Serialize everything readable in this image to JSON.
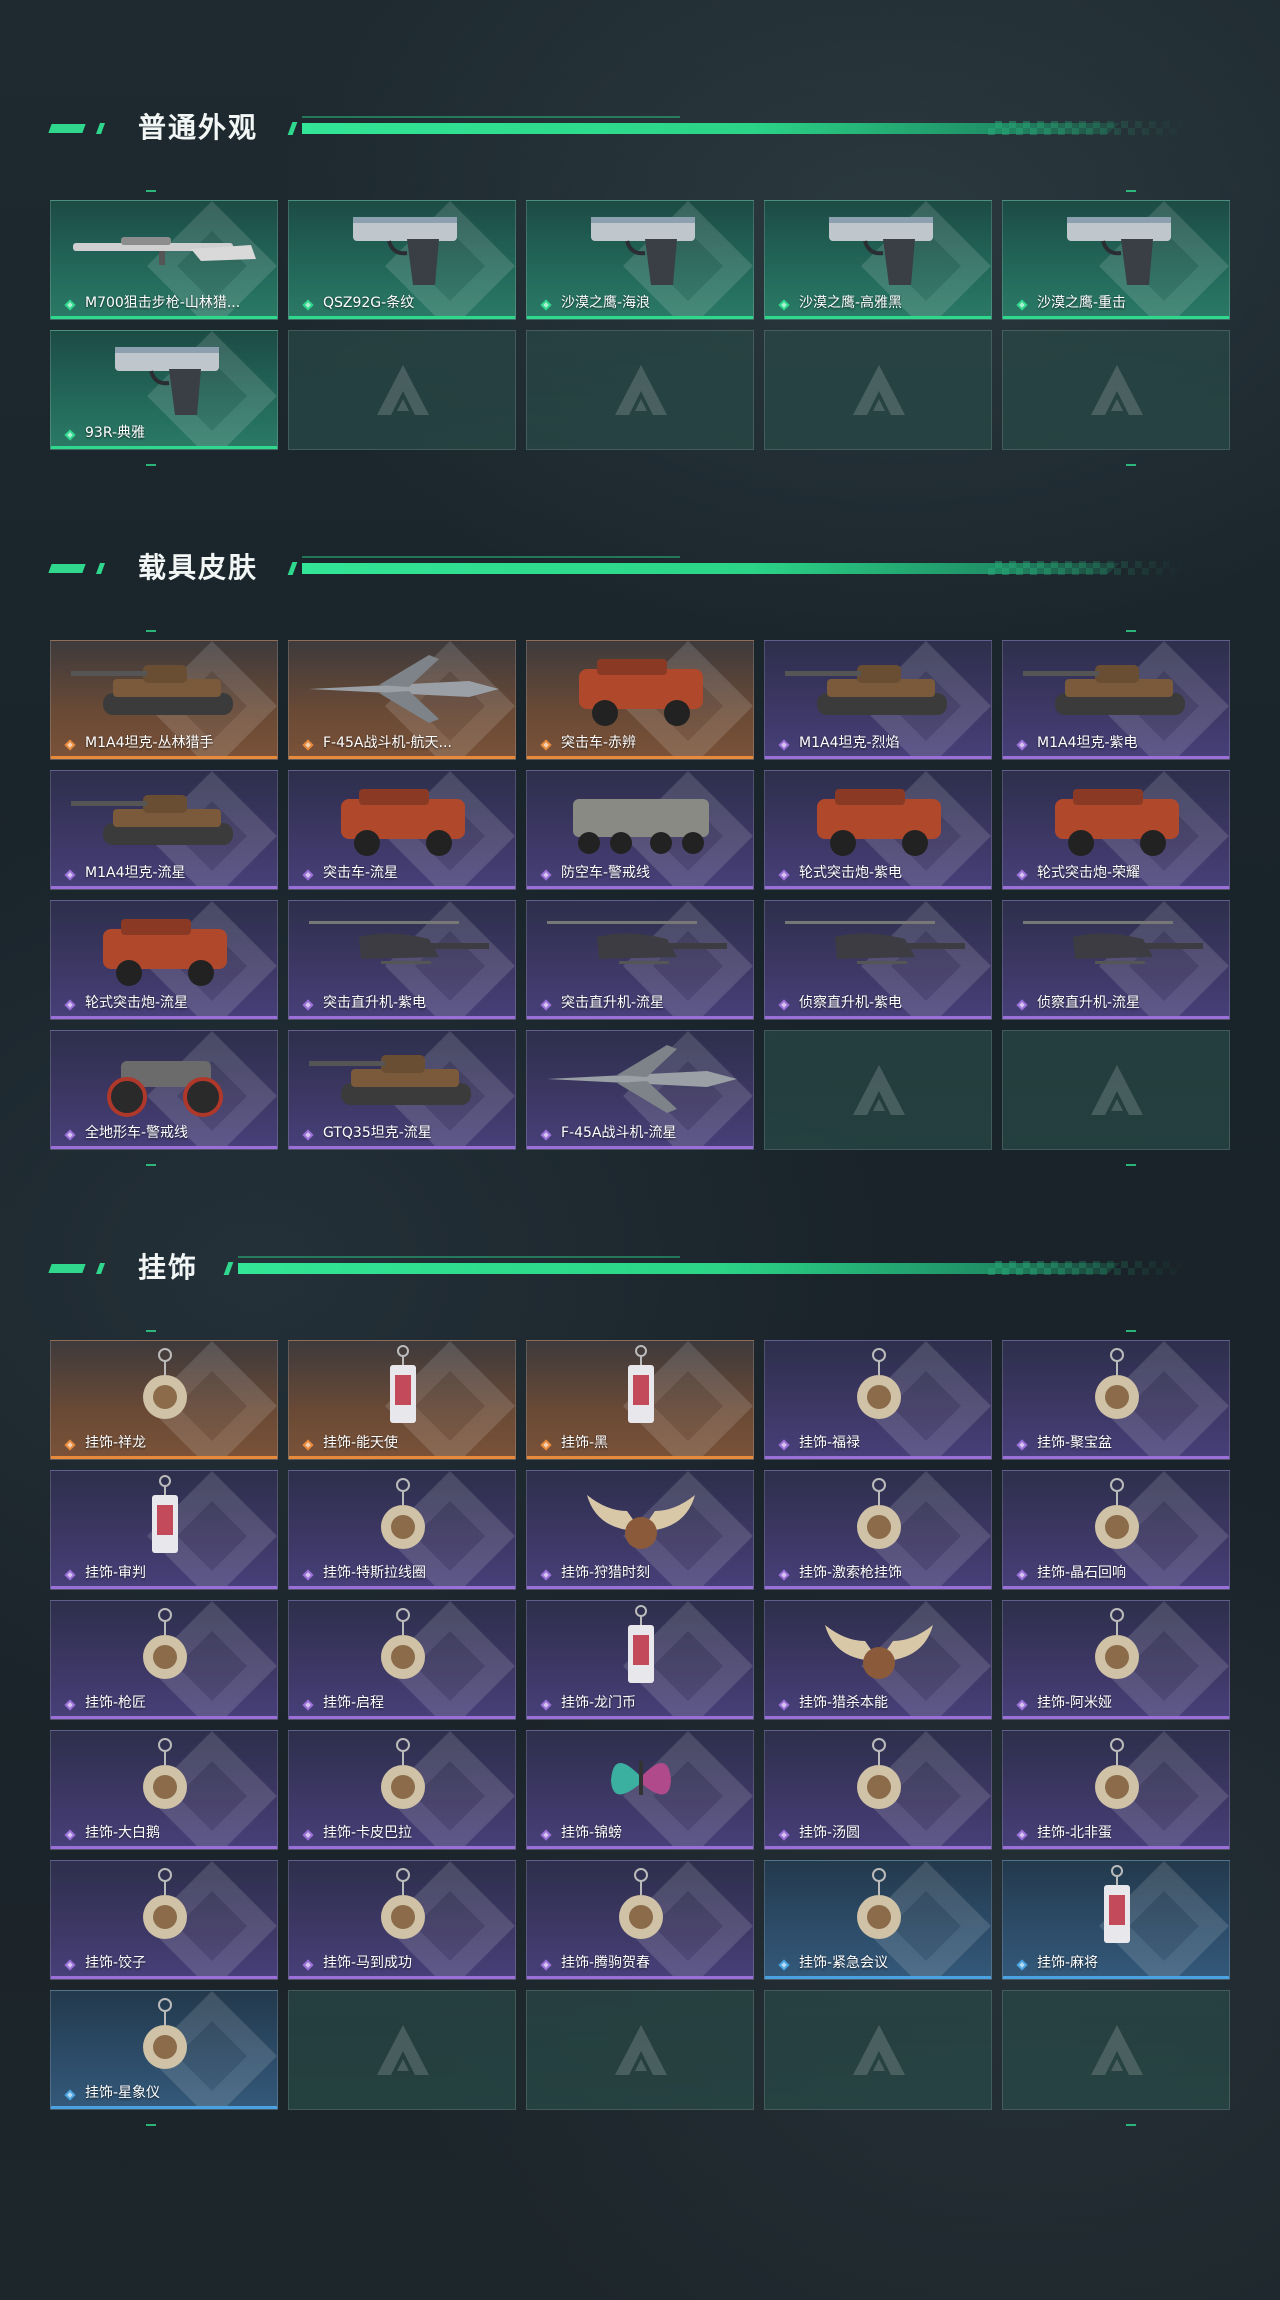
{
  "sections": [
    {
      "title": "普通外观",
      "items": [
        {
          "label": "M700狙击步枪-山林猎...",
          "rarity": "green",
          "art": "rifle-icon"
        },
        {
          "label": "QSZ92G-条纹",
          "rarity": "green",
          "art": "pistol-icon"
        },
        {
          "label": "沙漠之鹰-海浪",
          "rarity": "green",
          "art": "pistol-icon"
        },
        {
          "label": "沙漠之鹰-高雅黑",
          "rarity": "green",
          "art": "pistol-icon"
        },
        {
          "label": "沙漠之鹰-重击",
          "rarity": "green",
          "art": "pistol-icon"
        },
        {
          "label": "93R-典雅",
          "rarity": "green",
          "art": "pistol-icon"
        },
        {
          "empty": true
        },
        {
          "empty": true
        },
        {
          "empty": true
        },
        {
          "empty": true
        }
      ]
    },
    {
      "title": "载具皮肤",
      "items": [
        {
          "label": "M1A4坦克-丛林猎手",
          "rarity": "orange",
          "art": "tank-icon"
        },
        {
          "label": "F-45A战斗机-航天...",
          "rarity": "orange",
          "art": "jet-icon"
        },
        {
          "label": "突击车-赤辨",
          "rarity": "orange",
          "art": "armored-car-icon"
        },
        {
          "label": "M1A4坦克-烈焰",
          "rarity": "purple",
          "art": "tank-icon"
        },
        {
          "label": "M1A4坦克-紫电",
          "rarity": "purple",
          "art": "tank-icon"
        },
        {
          "label": "M1A4坦克-流星",
          "rarity": "purple",
          "art": "tank-icon"
        },
        {
          "label": "突击车-流星",
          "rarity": "purple",
          "art": "armored-car-icon"
        },
        {
          "label": "防空车-警戒线",
          "rarity": "purple",
          "art": "apc-icon"
        },
        {
          "label": "轮式突击炮-紫电",
          "rarity": "purple",
          "art": "armored-car-icon"
        },
        {
          "label": "轮式突击炮-荣耀",
          "rarity": "purple",
          "art": "armored-car-icon"
        },
        {
          "label": "轮式突击炮-流星",
          "rarity": "purple",
          "art": "armored-car-icon"
        },
        {
          "label": "突击直升机-紫电",
          "rarity": "purple",
          "art": "helicopter-icon"
        },
        {
          "label": "突击直升机-流星",
          "rarity": "purple",
          "art": "helicopter-icon"
        },
        {
          "label": "侦察直升机-紫电",
          "rarity": "purple",
          "art": "helicopter-icon"
        },
        {
          "label": "侦察直升机-流星",
          "rarity": "purple",
          "art": "helicopter-icon"
        },
        {
          "label": "全地形车-警戒线",
          "rarity": "purple",
          "art": "atv-icon"
        },
        {
          "label": "GTQ35坦克-流星",
          "rarity": "purple",
          "art": "tank-icon"
        },
        {
          "label": "F-45A战斗机-流星",
          "rarity": "purple",
          "art": "jet-icon"
        },
        {
          "empty": true
        },
        {
          "empty": true
        }
      ]
    },
    {
      "title": "挂饰",
      "items": [
        {
          "label": "挂饰-祥龙",
          "rarity": "orange",
          "art": "charm-icon"
        },
        {
          "label": "挂饰-能天使",
          "rarity": "orange",
          "art": "charm-tag-icon"
        },
        {
          "label": "挂饰-黑",
          "rarity": "orange",
          "art": "charm-tag-icon"
        },
        {
          "label": "挂饰-福禄",
          "rarity": "purple",
          "art": "charm-icon"
        },
        {
          "label": "挂饰-聚宝盆",
          "rarity": "purple",
          "art": "charm-icon"
        },
        {
          "label": "挂饰-审判",
          "rarity": "purple",
          "art": "charm-tag-icon"
        },
        {
          "label": "挂饰-特斯拉线圈",
          "rarity": "purple",
          "art": "charm-icon"
        },
        {
          "label": "挂饰-狩猎时刻",
          "rarity": "purple",
          "art": "antler-icon"
        },
        {
          "label": "挂饰-激索枪挂饰",
          "rarity": "purple",
          "art": "charm-icon"
        },
        {
          "label": "挂饰-晶石回响",
          "rarity": "purple",
          "art": "charm-icon"
        },
        {
          "label": "挂饰-枪匠",
          "rarity": "purple",
          "art": "charm-icon"
        },
        {
          "label": "挂饰-启程",
          "rarity": "purple",
          "art": "charm-icon"
        },
        {
          "label": "挂饰-龙门币",
          "rarity": "purple",
          "art": "charm-tag-icon"
        },
        {
          "label": "挂饰-猎杀本能",
          "rarity": "purple",
          "art": "antler-icon"
        },
        {
          "label": "挂饰-阿米娅",
          "rarity": "purple",
          "art": "charm-icon"
        },
        {
          "label": "挂饰-大白鹅",
          "rarity": "purple",
          "art": "charm-icon"
        },
        {
          "label": "挂饰-卡皮巴拉",
          "rarity": "purple",
          "art": "charm-icon"
        },
        {
          "label": "挂饰-锦螃",
          "rarity": "purple",
          "art": "butterfly-icon"
        },
        {
          "label": "挂饰-汤圆",
          "rarity": "purple",
          "art": "charm-icon"
        },
        {
          "label": "挂饰-北非蛋",
          "rarity": "purple",
          "art": "charm-icon"
        },
        {
          "label": "挂饰-饺子",
          "rarity": "purple",
          "art": "charm-icon"
        },
        {
          "label": "挂饰-马到成功",
          "rarity": "purple",
          "art": "charm-icon"
        },
        {
          "label": "挂饰-腾驹贺春",
          "rarity": "purple",
          "art": "charm-icon"
        },
        {
          "label": "挂饰-紧急会议",
          "rarity": "blue",
          "art": "charm-icon"
        },
        {
          "label": "挂饰-麻将",
          "rarity": "blue",
          "art": "charm-tag-icon"
        },
        {
          "label": "挂饰-星象仪",
          "rarity": "blue",
          "art": "charm-icon"
        },
        {
          "empty": true
        },
        {
          "empty": true
        },
        {
          "empty": true
        },
        {
          "empty": true
        }
      ]
    }
  ],
  "colors": {
    "accent": "#2fd88c",
    "green": "#2fd88c",
    "orange": "#e88a3c",
    "purple": "#9a6fd8",
    "blue": "#4aa3e0"
  }
}
